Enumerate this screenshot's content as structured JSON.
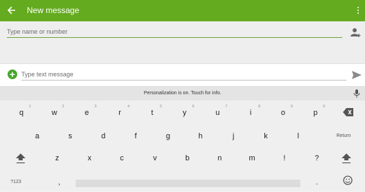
{
  "app_bar": {
    "title": "New message"
  },
  "recipient": {
    "placeholder": "Type name or number"
  },
  "compose": {
    "placeholder": "Type text message"
  },
  "keyboard": {
    "suggestion": "Personalization is on. Touch for info.",
    "row1": [
      {
        "key": "q",
        "hint": "1"
      },
      {
        "key": "w",
        "hint": "2"
      },
      {
        "key": "e",
        "hint": "3"
      },
      {
        "key": "r",
        "hint": "4"
      },
      {
        "key": "t",
        "hint": "5"
      },
      {
        "key": "y",
        "hint": "6"
      },
      {
        "key": "u",
        "hint": "7"
      },
      {
        "key": "i",
        "hint": "8"
      },
      {
        "key": "o",
        "hint": "9"
      },
      {
        "key": "p",
        "hint": "0"
      }
    ],
    "row2": [
      "a",
      "s",
      "d",
      "f",
      "g",
      "h",
      "j",
      "k",
      "l"
    ],
    "row3": [
      "z",
      "x",
      "c",
      "v",
      "b",
      "n",
      "m",
      "!",
      "?"
    ],
    "return_label": "Return",
    "symbols_label": "?123",
    "comma": ",",
    "period": "."
  },
  "colors": {
    "accent": "#64ab1f"
  }
}
